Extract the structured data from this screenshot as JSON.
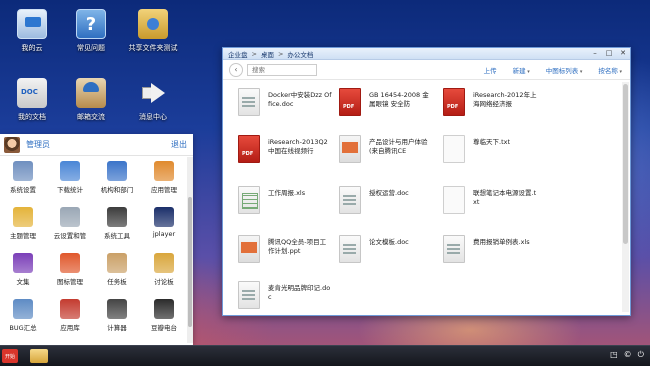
{
  "desktop": {
    "icons": [
      {
        "label": "我的云",
        "icon": "cloud-monitor-icon"
      },
      {
        "label": "常见问题",
        "icon": "help-question-icon"
      },
      {
        "label": "共享文件夹测试",
        "icon": "shared-folder-icon"
      },
      {
        "label": "我的文档",
        "icon": "documents-icon"
      },
      {
        "label": "邮箱交流",
        "icon": "mail-exchange-icon"
      },
      {
        "label": "消息中心",
        "icon": "message-center-icon"
      }
    ]
  },
  "explorer": {
    "breadcrumb": [
      "企业盘",
      "桌面",
      "办公文档"
    ],
    "breadcrumb_sep": ">",
    "search_placeholder": "搜索",
    "actions": {
      "upload": "上传",
      "new": "新建",
      "view": "中图标列表",
      "sort": "按名称"
    },
    "files": [
      {
        "name": "Docker中安装Dzz Office.doc",
        "type": "doc"
      },
      {
        "name": "GB 16454-2008 金属眼镜 安全防",
        "type": "pdf"
      },
      {
        "name": "iResearch-2012年上海网络经济报",
        "type": "pdf"
      },
      {
        "name": "iResearch-2013Q2中国在线视频行",
        "type": "pdf"
      },
      {
        "name": "产品设计与用户体验(来自腾讯CE",
        "type": "ppt"
      },
      {
        "name": "尊临天下.txt",
        "type": "txt"
      },
      {
        "name": "工作周报.xls",
        "type": "xls"
      },
      {
        "name": "授权运营.doc",
        "type": "doc"
      },
      {
        "name": "联想笔记本电源设置.txt",
        "type": "txt"
      },
      {
        "name": "腾讯QQ全员-项目工作计划.ppt",
        "type": "ppt"
      },
      {
        "name": "论文模板.doc",
        "type": "doc"
      },
      {
        "name": "费用报销单例表.xls",
        "type": "doc"
      },
      {
        "name": "麦肯光明品牌印记.doc",
        "type": "doc"
      }
    ]
  },
  "panel": {
    "user": "管理员",
    "logout": "退出",
    "apps": [
      {
        "label": "系统设置",
        "icon": "settings-icon",
        "color": "#6f8fbf"
      },
      {
        "label": "下载统计",
        "icon": "download-stats-icon",
        "color": "#4a86d6"
      },
      {
        "label": "机构和部门",
        "icon": "org-departments-icon",
        "color": "#3b74c9"
      },
      {
        "label": "应用管理",
        "icon": "app-management-icon",
        "color": "#e08a2e"
      },
      {
        "label": "主题管理",
        "icon": "theme-icon",
        "color": "#e4b33a"
      },
      {
        "label": "云设置和管",
        "icon": "cloud-settings-icon",
        "color": "#9aa7b5"
      },
      {
        "label": "系统工具",
        "icon": "system-tools-icon",
        "color": "#3c3c3c"
      },
      {
        "label": "jplayer",
        "icon": "jplayer-icon",
        "color": "#1b2f6a"
      },
      {
        "label": "文集",
        "icon": "anthology-icon",
        "color": "#7b3fb8"
      },
      {
        "label": "图标管理",
        "icon": "icon-management-icon",
        "color": "#e0582c"
      },
      {
        "label": "任务板",
        "icon": "task-board-icon",
        "color": "#caa067"
      },
      {
        "label": "讨论板",
        "icon": "discussion-board-icon",
        "color": "#d9a63c"
      },
      {
        "label": "BUG汇总",
        "icon": "bug-summary-icon",
        "color": "#5e8bc4"
      },
      {
        "label": "应用库",
        "icon": "app-store-icon",
        "color": "#c33b2f"
      },
      {
        "label": "计算器",
        "icon": "calculator-icon",
        "color": "#444444"
      },
      {
        "label": "豆瓣电台",
        "icon": "douban-radio-icon",
        "color": "#2b2b2b"
      }
    ]
  },
  "taskbar": {
    "start_label": "开始",
    "tray_icons": [
      "notification-icon",
      "copyright-icon",
      "power-icon"
    ]
  }
}
